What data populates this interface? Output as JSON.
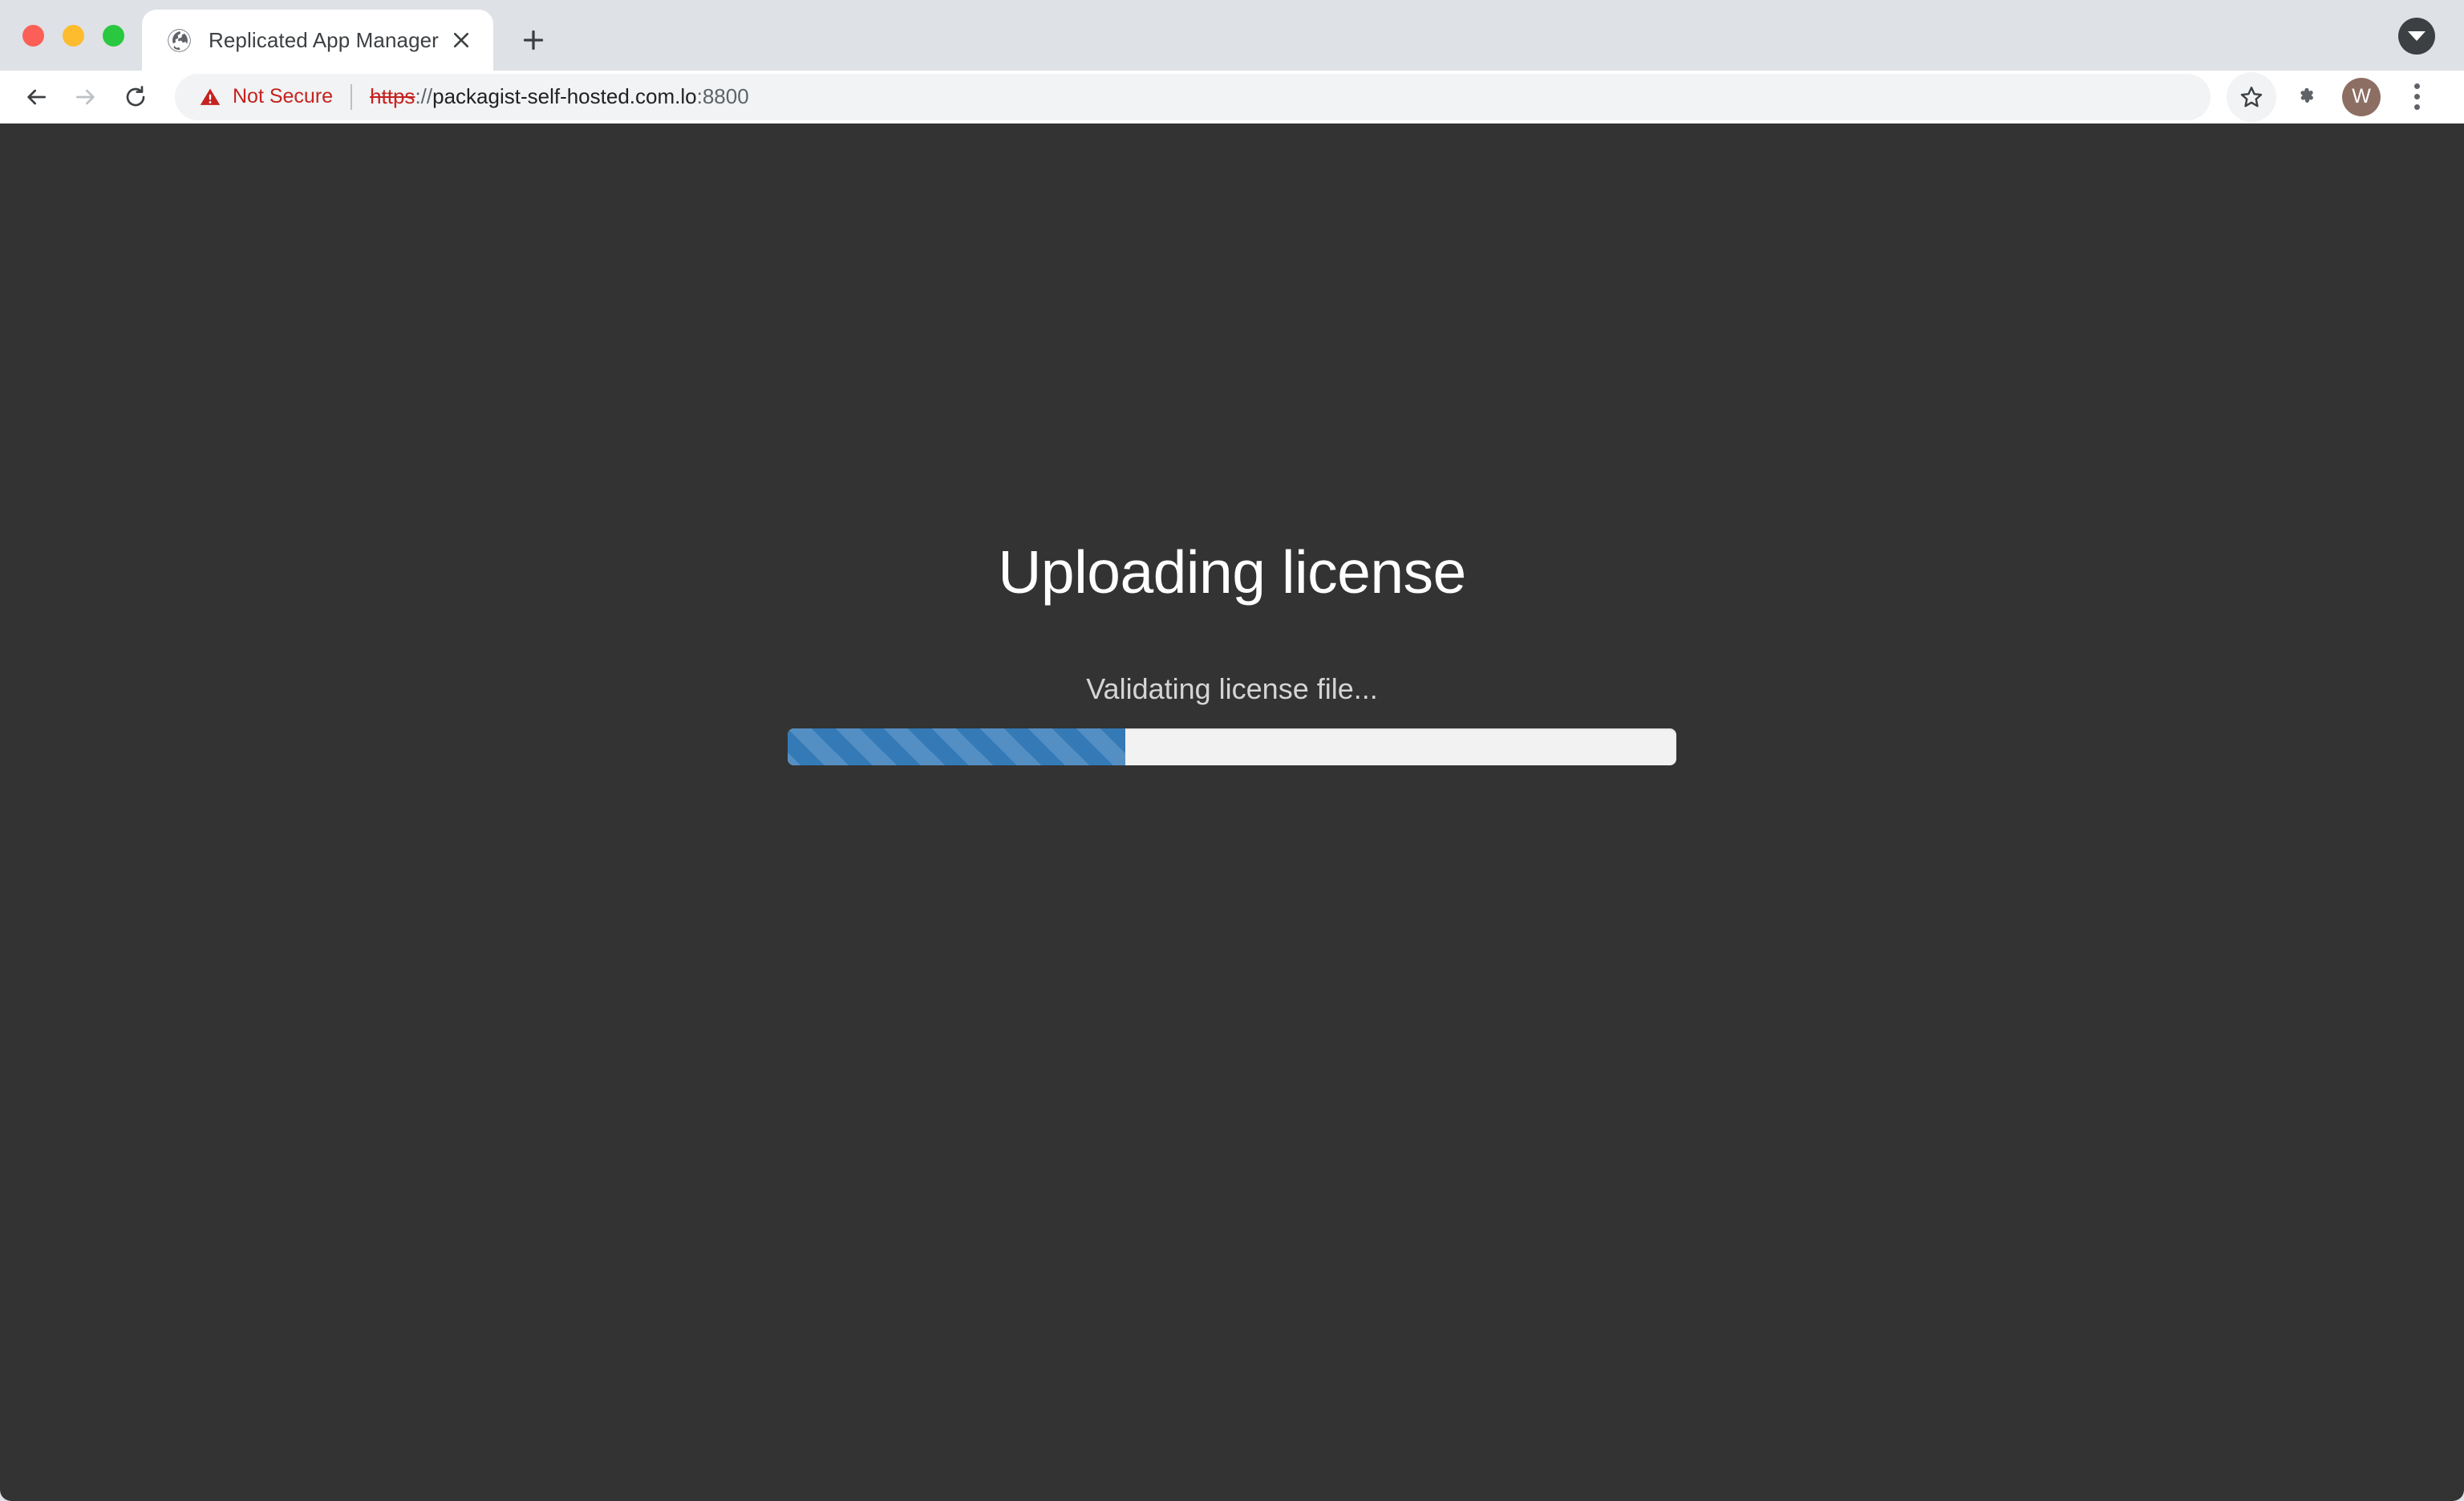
{
  "browser": {
    "window_controls": [
      {
        "name": "close",
        "color": "#fc5f57"
      },
      {
        "name": "minimize",
        "color": "#fdbc2e"
      },
      {
        "name": "maximize",
        "color": "#29c840"
      }
    ],
    "tabs": [
      {
        "title": "Replicated App Manager",
        "favicon": "globe-icon",
        "active": true,
        "close_label": "×"
      }
    ],
    "new_tab_label": "+",
    "tab_search_label": "Search tabs",
    "nav": {
      "back_label": "Back",
      "forward_label": "Forward",
      "reload_label": "Reload"
    },
    "omnibox": {
      "security_icon": "warning-triangle-icon",
      "security_text": "Not Secure",
      "url_scheme": "https",
      "url_separator": "://",
      "url_host": "packagist-self-hosted.com.lo",
      "url_port": ":8800",
      "full_url": "https://packagist-self-hosted.com.lo:8800"
    },
    "toolbar_right": {
      "bookmark_label": "Bookmark this tab",
      "extensions_label": "Extensions",
      "avatar_initial": "W",
      "menu_label": "Customize and control Google Chrome"
    }
  },
  "page": {
    "title": "Uploading license",
    "status": "Validating license file...",
    "progress": {
      "percent": 38,
      "fill_color": "#337ab7",
      "track_color": "#f2f2f2",
      "striped": true,
      "animated": true
    },
    "background_color": "#333333",
    "title_color": "#ffffff",
    "status_color": "#d5d5d5"
  }
}
